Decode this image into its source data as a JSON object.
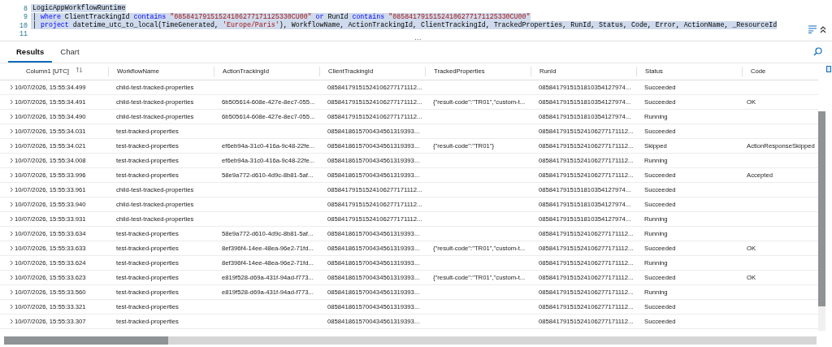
{
  "editor": {
    "lines": [
      {
        "number": "8",
        "selected": true,
        "segments": [
          {
            "kind": "plain",
            "text": "LogicAppWorkflowRuntime"
          }
        ]
      },
      {
        "number": "9",
        "selected": true,
        "segments": [
          {
            "kind": "plain",
            "text": "| "
          },
          {
            "kind": "kw",
            "text": "where"
          },
          {
            "kind": "plain",
            "text": " ClientTrackingId "
          },
          {
            "kind": "kw",
            "text": "contains"
          },
          {
            "kind": "str",
            "text": " \"08584179151524106277171125330CU00\" "
          },
          {
            "kind": "kw",
            "text": "or"
          },
          {
            "kind": "plain",
            "text": " RunId "
          },
          {
            "kind": "kw",
            "text": "contains"
          },
          {
            "kind": "str",
            "text": " \"08584179151524106277171125330CU00\""
          }
        ]
      },
      {
        "number": "10",
        "selected": true,
        "segments": [
          {
            "kind": "plain",
            "text": "| "
          },
          {
            "kind": "kw",
            "text": "project"
          },
          {
            "kind": "plain",
            "text": " datetime_utc_to_local(TimeGenerated, "
          },
          {
            "kind": "str",
            "text": "'Europe/Paris'"
          },
          {
            "kind": "plain",
            "text": "), WorkflowName, ActionTrackingId, ClientTrackingId, TrackedProperties, RunId, Status, Code, Error, ActionName, _ResourceId"
          }
        ]
      },
      {
        "number": "11",
        "selected": false
      }
    ]
  },
  "splitter": "...",
  "tabs": [
    {
      "label": "Results",
      "selected": true
    },
    {
      "label": "Chart",
      "selected": false
    }
  ],
  "table": {
    "columns": [
      "Column1 [UTC]",
      "WorkflowName",
      "ActionTrackingId",
      "ClientTrackingId",
      "TrackedProperties",
      "RunId",
      "Status",
      "Code"
    ],
    "rows": [
      [
        "10/07/2026, 15:55:34.499",
        "child-test-tracked-properties",
        "",
        "08584179151524106277171112...",
        "",
        "0858417915151810354127974...",
        "Succeeded",
        ""
      ],
      [
        "10/07/2026, 15:55:34.491",
        "child-test-tracked-properties",
        "6b505614-608e-427e-8ec7-055...",
        "08584179151524106277171112...",
        "{\"result-code\":\"TR01\",\"custom-t...",
        "0858417915151810354127974...",
        "Succeeded",
        "OK"
      ],
      [
        "10/07/2026, 15:55:34.490",
        "child-test-tracked-properties",
        "6b505614-608e-427e-8ec7-055...",
        "08584179151524106277171112...",
        "",
        "0858417915151810354127974...",
        "Running",
        ""
      ],
      [
        "10/07/2026, 15:55:34.031",
        "test-tracked-properties",
        "",
        "0858418615700434561319393...",
        "",
        "08584179151524106277171112...",
        "Succeeded",
        ""
      ],
      [
        "10/07/2026, 15:55:34.021",
        "test-tracked-properties",
        "ef6eb94a-31c0-416a-9c48-22fe...",
        "0858418615700434561319393...",
        "{\"result-code\":\"TR01\"}",
        "08584179151524106277171112...",
        "Skipped",
        "ActionResponseSkipped"
      ],
      [
        "10/07/2026, 15:55:34.008",
        "test-tracked-properties",
        "ef6eb94a-31c0-416a-9c48-22fe...",
        "0858418615700434561319393...",
        "",
        "08584179151524106277171112...",
        "Running",
        ""
      ],
      [
        "10/07/2026, 15:55:33.996",
        "test-tracked-properties",
        "58e9a772-d610-4d9c-8b81-5af...",
        "0858418615700434561319393...",
        "",
        "08584179151524106277171112...",
        "Succeeded",
        "Accepted"
      ],
      [
        "10/07/2026, 15:55:33.961",
        "child-test-tracked-properties",
        "",
        "08584179151524106277171112...",
        "",
        "0858417915151810354127974...",
        "Succeeded",
        ""
      ],
      [
        "10/07/2026, 15:55:33.940",
        "child-test-tracked-properties",
        "",
        "08584179151524106277171112...",
        "",
        "0858417915151810354127974...",
        "Succeeded",
        ""
      ],
      [
        "10/07/2026, 15:55:33.931",
        "child-test-tracked-properties",
        "",
        "08584179151524106277171112...",
        "",
        "0858417915151810354127974...",
        "Running",
        ""
      ],
      [
        "10/07/2026, 15:55:33.634",
        "test-tracked-properties",
        "58e9a772-d610-4d9c-8b81-5af...",
        "0858418615700434561319393...",
        "",
        "08584179151524106277171112...",
        "Running",
        ""
      ],
      [
        "10/07/2026, 15:55:33.633",
        "test-tracked-properties",
        "8ef396f4-14ee-48ea-96e2-71fd...",
        "0858418615700434561319393...",
        "{\"result-code\":\"TR01\",\"custom-t...",
        "08584179151524106277171112...",
        "Succeeded",
        "OK"
      ],
      [
        "10/07/2026, 15:55:33.624",
        "test-tracked-properties",
        "8ef396f4-14ee-48ea-96e2-71fd...",
        "0858418615700434561319393...",
        "",
        "08584179151524106277171112...",
        "Running",
        ""
      ],
      [
        "10/07/2026, 15:55:33.623",
        "test-tracked-properties",
        "e819f528-d69a-431f-94ad-f773...",
        "0858418615700434561319393...",
        "{\"result-code\":\"TR01\",\"custom-t...",
        "08584179151524106277171112...",
        "Succeeded",
        "OK"
      ],
      [
        "10/07/2026, 15:55:33.560",
        "test-tracked-properties",
        "e819f528-d69a-431f-94ad-f773...",
        "0858418615700434561319393...",
        "",
        "08584179151524106277171112...",
        "Running",
        ""
      ],
      [
        "10/07/2026, 15:55:33.321",
        "test-tracked-properties",
        "",
        "0858418615700434561319393...",
        "",
        "08584179151524106277171112...",
        "Succeeded",
        ""
      ],
      [
        "10/07/2026, 15:55:33.307",
        "test-tracked-properties",
        "",
        "0858418615700434561319393...",
        "",
        "08584179151524106277171112...",
        "Succeeded",
        ""
      ]
    ]
  }
}
